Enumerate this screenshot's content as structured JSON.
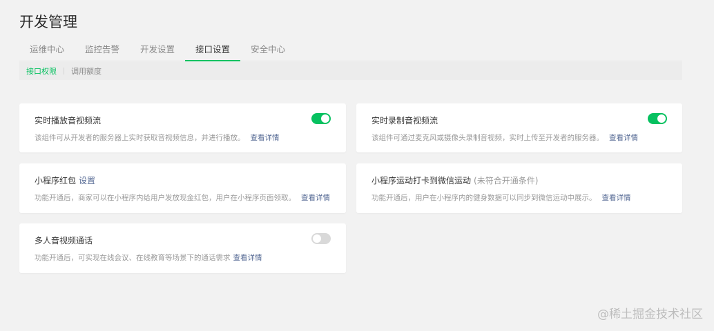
{
  "page": {
    "title": "开发管理"
  },
  "tabs": [
    {
      "label": "运维中心"
    },
    {
      "label": "监控告警"
    },
    {
      "label": "开发设置"
    },
    {
      "label": "接口设置",
      "active": true
    },
    {
      "label": "安全中心"
    }
  ],
  "subtabs": [
    {
      "label": "接口权限",
      "active": true
    },
    {
      "label": "调用额度"
    }
  ],
  "cards": [
    {
      "title": "实时播放音视频流",
      "desc": "该组件可从开发者的服务器上实时获取音视频信息，并进行播放。",
      "link": "查看详情",
      "toggle": "on"
    },
    {
      "title": "实时录制音视频流",
      "desc": "该组件可通过麦克风或摄像头录制音视频，实时上传至开发者的服务器。",
      "link": "查看详情",
      "toggle": "on"
    },
    {
      "title": "小程序红包",
      "title_link": "设置",
      "desc": "功能开通后，商家可以在小程序内给用户发放现金红包，用户在小程序页面领取。",
      "link": "查看详情"
    },
    {
      "title": "小程序运动打卡到微信运动",
      "title_note": "(未符合开通条件)",
      "desc": "功能开通后，用户在小程序内的健身数据可以同步到微信运动中展示。",
      "link": "查看详情"
    },
    {
      "title": "多人音视频通话",
      "desc": "功能开通后，可实现在线会议、在线教育等场景下的通话需求",
      "link": "查看详情",
      "toggle": "off"
    }
  ],
  "watermark": "@稀土掘金技术社区",
  "colors": {
    "accent": "#07c160",
    "link": "#576b95",
    "background": "#f2f2f2"
  }
}
